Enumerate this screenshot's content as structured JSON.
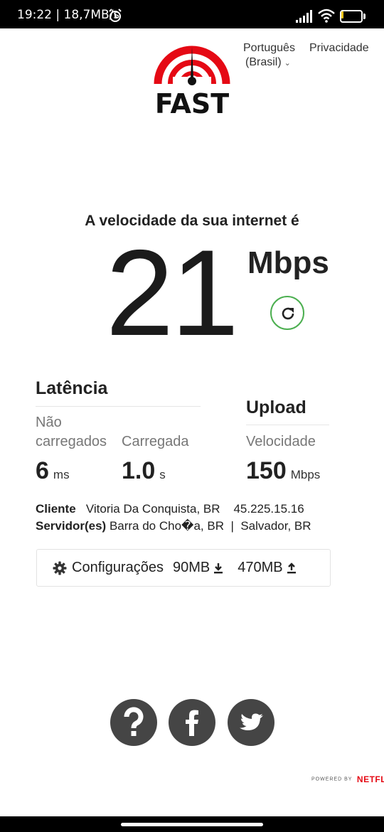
{
  "status_bar": {
    "time_speed": "19:22 | 18,7MB/s",
    "battery_level": "12",
    "battery_fraction": 0.12,
    "icons": [
      "alarm-icon",
      "signal-icon",
      "wifi-icon",
      "battery-icon"
    ]
  },
  "header": {
    "logo_text": "FAST",
    "language_line1": "Português",
    "language_line2": "(Brasil)",
    "privacy": "Privacidade"
  },
  "speed": {
    "heading": "A velocidade da sua internet é",
    "value": "21",
    "units": "Mbps"
  },
  "latency": {
    "title": "Latência",
    "unloaded_label": "Não carregados",
    "unloaded_value": "6",
    "unloaded_unit": "ms",
    "loaded_label": "Carregada",
    "loaded_value": "1.0",
    "loaded_unit": "s"
  },
  "upload": {
    "title": "Upload",
    "speed_label": "Velocidade",
    "value": "150",
    "unit": "Mbps"
  },
  "client": {
    "label": "Cliente",
    "location": "Vitoria Da Conquista, BR",
    "ip": "45.225.15.16"
  },
  "server": {
    "label": "Servidor(es)",
    "location1": "Barra do Cho�a, BR",
    "separator": "|",
    "location2": "Salvador, BR"
  },
  "settings": {
    "label": "Configurações",
    "download_size": "90MB",
    "upload_size": "470MB"
  },
  "social": {
    "icons": [
      "help-icon",
      "facebook-icon",
      "twitter-icon"
    ]
  },
  "footer": {
    "powered_by": "POWERED BY",
    "brand": "NETFLIX"
  },
  "colors": {
    "accent_red": "#e50914",
    "refresh_green": "#4caf50",
    "social_gray": "#454545"
  }
}
